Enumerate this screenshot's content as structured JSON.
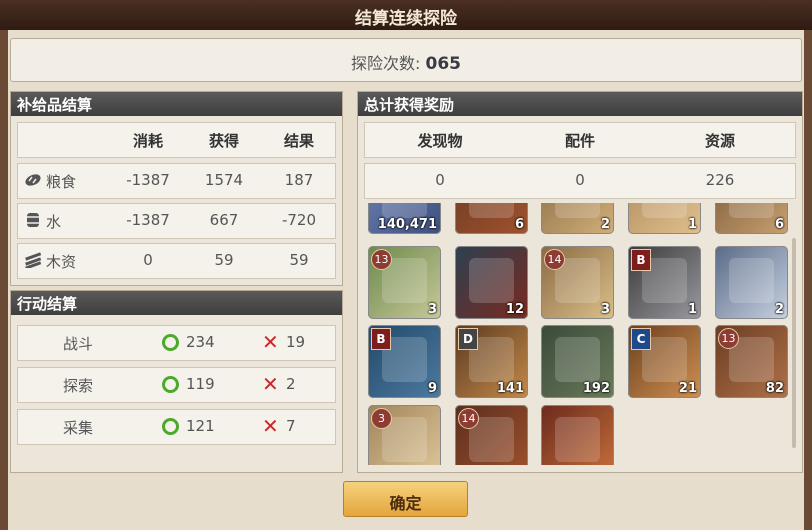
{
  "title": "结算连续探险",
  "exploration_count": {
    "label": "探险次数:",
    "value": "065"
  },
  "supplies": {
    "header": "补给品结算",
    "columns": [
      "消耗",
      "获得",
      "结果"
    ],
    "rows": [
      {
        "icon": "bread-icon",
        "name": "粮食",
        "consumed": "-1387",
        "gained": "1574",
        "result": "187"
      },
      {
        "icon": "barrel-icon",
        "name": "水",
        "consumed": "-1387",
        "gained": "667",
        "result": "-720"
      },
      {
        "icon": "planks-icon",
        "name": "木资",
        "consumed": "0",
        "gained": "59",
        "result": "59"
      }
    ]
  },
  "actions": {
    "header": "行动结算",
    "rows": [
      {
        "name": "战斗",
        "success": "234",
        "fail": "19"
      },
      {
        "name": "探索",
        "success": "119",
        "fail": "2"
      },
      {
        "name": "采集",
        "success": "121",
        "fail": "7"
      }
    ]
  },
  "rewards": {
    "header": "总计获得奖励",
    "columns": [
      "发现物",
      "配件",
      "资源"
    ],
    "values": [
      "0",
      "0",
      "226"
    ],
    "items": [
      {
        "icon": "medal-icon",
        "qty": "140,471",
        "badge": ""
      },
      {
        "icon": "chest-icon",
        "qty": "6",
        "badge": ""
      },
      {
        "icon": "map-scroll-icon",
        "qty": "2",
        "badge": ""
      },
      {
        "icon": "parchment-icon",
        "qty": "1",
        "badge": ""
      },
      {
        "icon": "ship-model-icon",
        "qty": "6",
        "badge": ""
      },
      {
        "icon": "ship-chart-icon",
        "qty": "3",
        "badge": "13"
      },
      {
        "icon": "lobster-icon",
        "qty": "12",
        "badge": ""
      },
      {
        "icon": "ship-scroll-icon",
        "qty": "3",
        "badge": "14"
      },
      {
        "icon": "astrolabe-icon",
        "qty": "1",
        "badge": "B"
      },
      {
        "icon": "vase-icon",
        "qty": "2",
        "badge": ""
      },
      {
        "icon": "book-icon",
        "qty": "9",
        "badge": "B"
      },
      {
        "icon": "compass-icon",
        "qty": "141",
        "badge": "D"
      },
      {
        "icon": "crate-icon",
        "qty": "192",
        "badge": ""
      },
      {
        "icon": "compass-gold-icon",
        "qty": "21",
        "badge": "C"
      },
      {
        "icon": "lumber-icon",
        "qty": "82",
        "badge": "13"
      },
      {
        "icon": "scroll-icon",
        "qty": "",
        "badge": "3"
      },
      {
        "icon": "wood-boards-icon",
        "qty": "",
        "badge": "14"
      },
      {
        "icon": "red-planks-icon",
        "qty": "",
        "badge": ""
      }
    ]
  },
  "confirm_label": "确定",
  "colors": {
    "success": "#4caa2a",
    "fail": "#c72a2a",
    "button": "#e4a63b"
  }
}
